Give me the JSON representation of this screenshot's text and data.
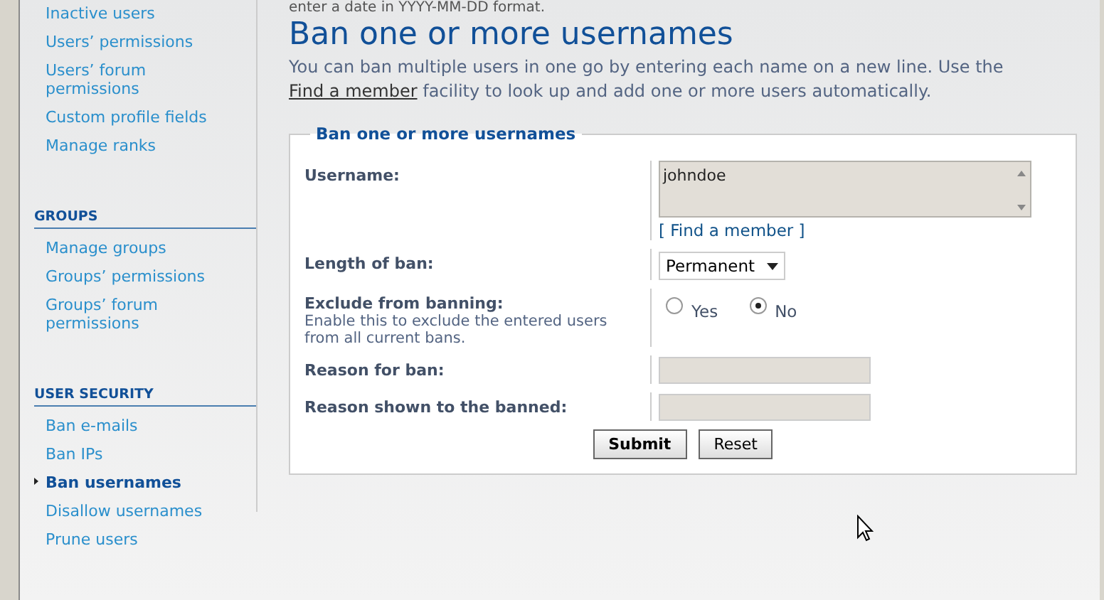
{
  "sidebar": {
    "sections": [
      {
        "items": [
          {
            "label": "Inactive users",
            "selected": false
          },
          {
            "label": "Users’ permissions",
            "selected": false
          },
          {
            "label": "Users’ forum permissions",
            "selected": false
          },
          {
            "label": "Custom profile fields",
            "selected": false
          },
          {
            "label": "Manage ranks",
            "selected": false
          }
        ]
      },
      {
        "heading": "GROUPS",
        "items": [
          {
            "label": "Manage groups",
            "selected": false
          },
          {
            "label": "Groups’ permissions",
            "selected": false
          },
          {
            "label": "Groups’ forum permissions",
            "selected": false
          }
        ]
      },
      {
        "heading": "USER SECURITY",
        "items": [
          {
            "label": "Ban e-mails",
            "selected": false
          },
          {
            "label": "Ban IPs",
            "selected": false
          },
          {
            "label": "Ban usernames",
            "selected": true
          },
          {
            "label": "Disallow usernames",
            "selected": false
          },
          {
            "label": "Prune users",
            "selected": false
          }
        ]
      }
    ]
  },
  "cut_text": "enter a date in YYYY-MM-DD format.",
  "title": "Ban one or more usernames",
  "intro": {
    "before": "You can ban multiple users in one go by entering each name on a new line. Use the",
    "link": "Find a member",
    "after": "facility to look up and add one or more users automatically."
  },
  "form": {
    "legend": "Ban one or more usernames",
    "rows": [
      {
        "kind": "textarea",
        "label": "Username:",
        "value": "johndoe",
        "link": "[ Find a member ]"
      },
      {
        "kind": "select",
        "label": "Length of ban:",
        "value": "Permanent"
      },
      {
        "kind": "radio",
        "label": "Exclude from banning:",
        "explain": "Enable this to exclude the entered users from all current bans.",
        "options": [
          {
            "label": "Yes",
            "selected": false
          },
          {
            "label": "No",
            "selected": true
          }
        ]
      },
      {
        "kind": "text",
        "label": "Reason for ban:",
        "value": ""
      },
      {
        "kind": "text",
        "label": "Reason shown to the banned:",
        "value": ""
      }
    ],
    "buttons": [
      {
        "label": "Submit",
        "primary": true
      },
      {
        "label": "Reset",
        "primary": false
      }
    ]
  }
}
